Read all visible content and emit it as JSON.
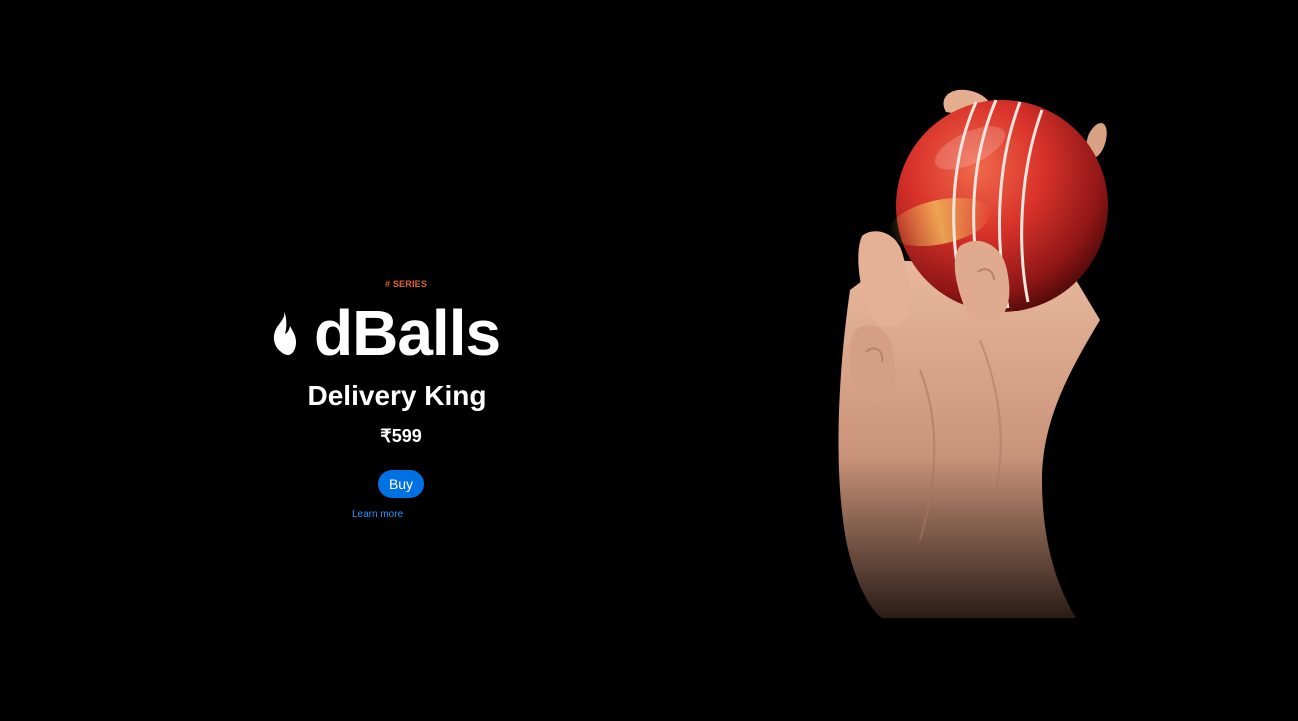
{
  "hero": {
    "eyebrow": "# SERIES",
    "brand": "dBalls",
    "product_name": "Delivery King",
    "price": "₹599",
    "buy_label": "Buy",
    "learn_more_label": "Learn more"
  },
  "colors": {
    "background": "#000000",
    "eyebrow": "#e0622a",
    "button": "#0071e3",
    "link": "#2997ff",
    "ball": "#d8322a",
    "skin": "#e9b89c"
  },
  "icons": {
    "logo": "flame-icon"
  },
  "image": {
    "subject": "hand-holding-cricket-ball"
  }
}
